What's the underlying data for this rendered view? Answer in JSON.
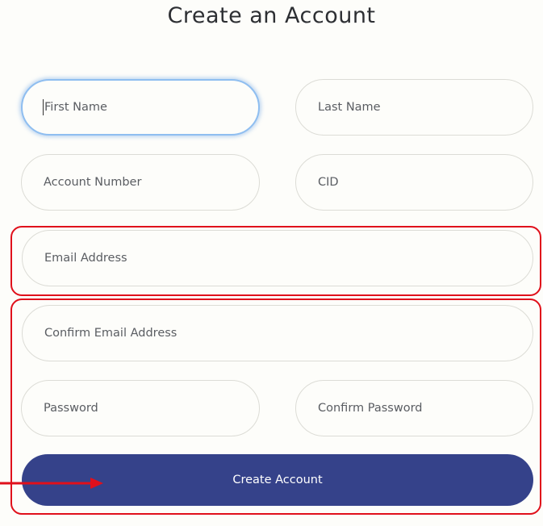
{
  "page": {
    "title": "Create an Account"
  },
  "form": {
    "first_name": {
      "placeholder": "First Name",
      "value": ""
    },
    "last_name": {
      "placeholder": "Last Name",
      "value": ""
    },
    "account_number": {
      "placeholder": "Account Number",
      "value": ""
    },
    "cid": {
      "placeholder": "CID",
      "value": ""
    },
    "email": {
      "placeholder": "Email Address",
      "value": ""
    },
    "confirm_email": {
      "placeholder": "Confirm Email Address",
      "value": ""
    },
    "password": {
      "placeholder": "Password",
      "value": ""
    },
    "confirm_password": {
      "placeholder": "Confirm Password",
      "value": ""
    },
    "submit_label": "Create Account"
  },
  "annotations": {
    "highlight_color": "#e0101b"
  },
  "colors": {
    "accent": "#35428a",
    "focus": "#8fbef0",
    "border": "#dcdcd6",
    "background": "#fdfdfa"
  }
}
